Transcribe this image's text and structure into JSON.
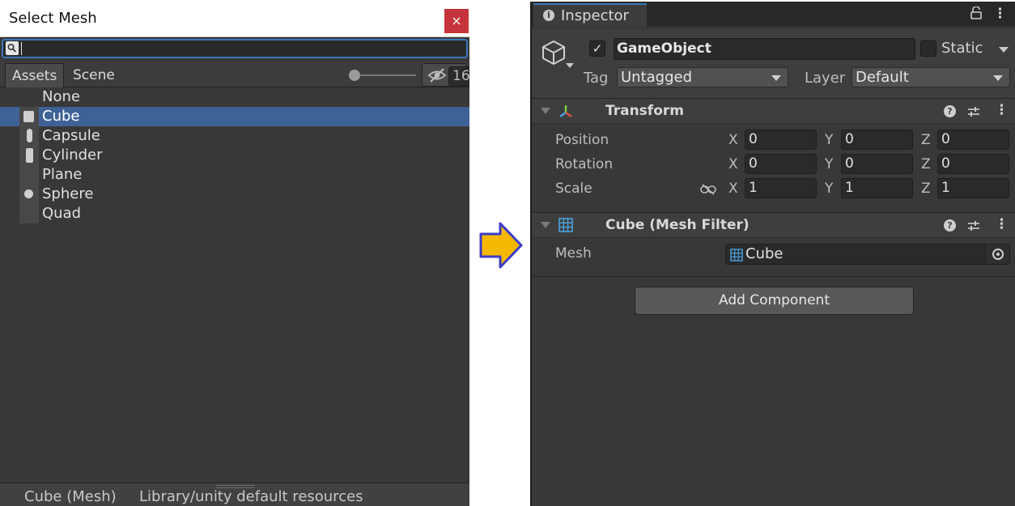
{
  "select_mesh": {
    "title": "Select Mesh",
    "close_glyph": "×",
    "search": {
      "value": ""
    },
    "tabs": [
      "Assets",
      "Scene"
    ],
    "visibility_count": "16",
    "items": [
      {
        "label": "None",
        "selected": false
      },
      {
        "label": "Cube",
        "selected": true
      },
      {
        "label": "Capsule",
        "selected": false
      },
      {
        "label": "Cylinder",
        "selected": false
      },
      {
        "label": "Plane",
        "selected": false
      },
      {
        "label": "Sphere",
        "selected": false
      },
      {
        "label": "Quad",
        "selected": false
      }
    ],
    "status": {
      "selection": "Cube (Mesh)",
      "path": "Library/unity default resources"
    }
  },
  "arrow": {
    "fill": "#f5b800",
    "stroke": "#3c3cc8"
  },
  "inspector": {
    "tab_label": "Inspector",
    "info_glyph": "i",
    "lock_glyph": "🔓",
    "menu_glyph": "⋮",
    "gameobject": {
      "active_check": "✓",
      "name": "GameObject",
      "static_label": "Static",
      "tag_label": "Tag",
      "tag_value": "Untagged",
      "layer_label": "Layer",
      "layer_value": "Default"
    },
    "transform": {
      "title": "Transform",
      "help_glyph": "?",
      "more_glyph": "⋮",
      "axis_labels": [
        "X",
        "Y",
        "Z"
      ],
      "rows": [
        {
          "label": "Position",
          "values": [
            "0",
            "0",
            "0"
          ]
        },
        {
          "label": "Rotation",
          "values": [
            "0",
            "0",
            "0"
          ]
        },
        {
          "label": "Scale",
          "values": [
            "1",
            "1",
            "1"
          ]
        }
      ]
    },
    "mesh_filter": {
      "title": "Cube (Mesh Filter)",
      "help_glyph": "?",
      "more_glyph": "⋮",
      "mesh_label": "Mesh",
      "mesh_value": "Cube"
    },
    "add_component_label": "Add Component"
  },
  "colors": {
    "accent": "#3a79bb",
    "selection": "#3f6296",
    "close_red": "#c4343a",
    "mesh_icon": "#4aa3df"
  }
}
